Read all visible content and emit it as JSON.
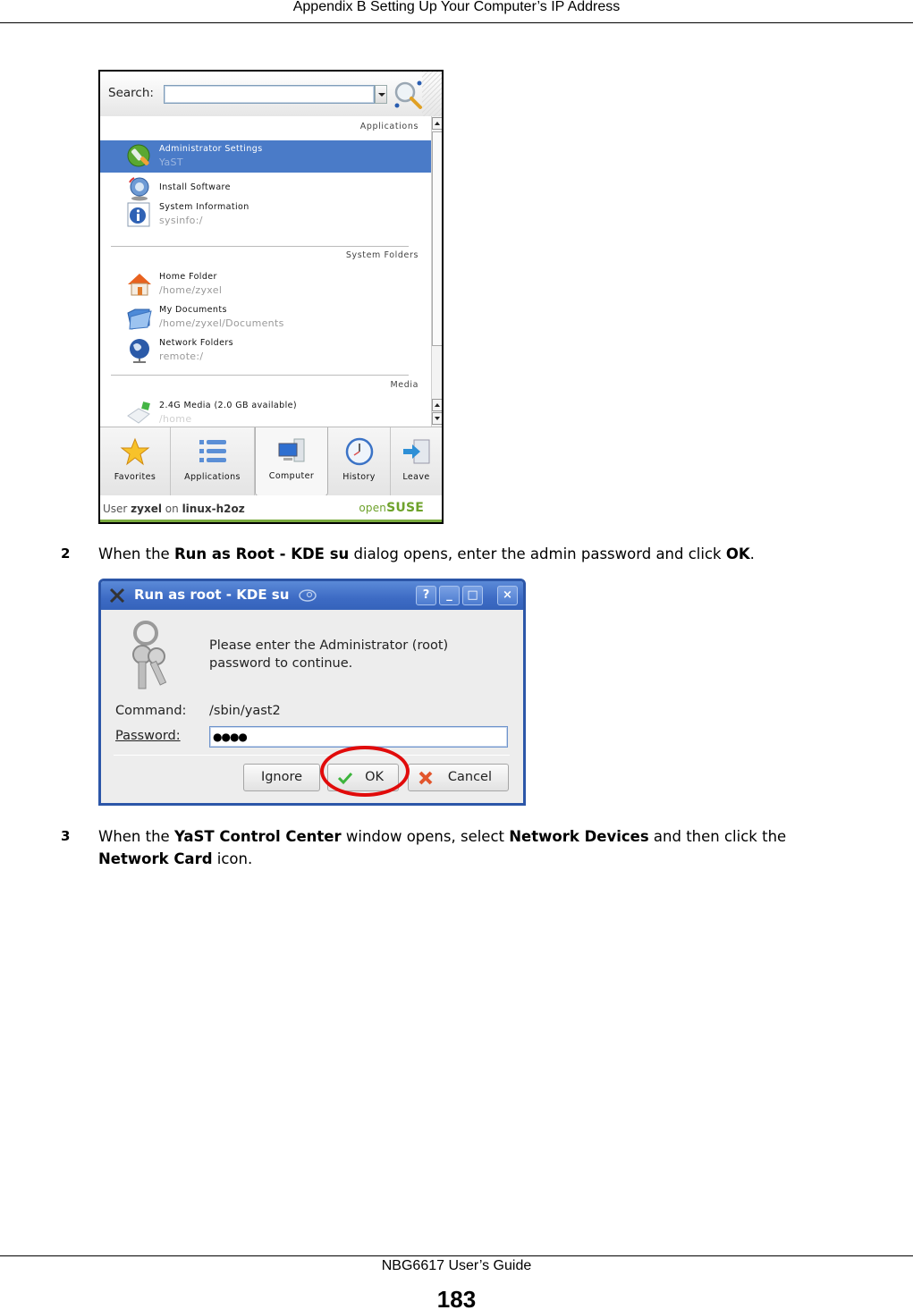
{
  "page": {
    "header": "Appendix B Setting Up Your Computer’s IP Address",
    "footer_guide": "NBG6617 User’s Guide",
    "page_number": "183"
  },
  "steps": [
    {
      "number": "2",
      "parts": [
        {
          "text": "When the ",
          "bold": false
        },
        {
          "text": "Run as Root - KDE su",
          "bold": true
        },
        {
          "text": " dialog opens, enter the admin password and click ",
          "bold": false
        },
        {
          "text": "OK",
          "bold": true
        },
        {
          "text": ".",
          "bold": false
        }
      ]
    },
    {
      "number": "3",
      "line1": [
        {
          "text": "When the ",
          "bold": false
        },
        {
          "text": "YaST Control Center",
          "bold": true
        },
        {
          "text": " window opens, select ",
          "bold": false
        },
        {
          "text": "Network Devices",
          "bold": true
        },
        {
          "text": " and then click the",
          "bold": false
        }
      ],
      "line2": [
        {
          "text": "Network Card",
          "bold": true
        },
        {
          "text": " icon.",
          "bold": false
        }
      ]
    }
  ],
  "kde_menu": {
    "search_label": "Search:",
    "search_value": "",
    "sections": {
      "applications": "Applications",
      "system_folders": "System Folders",
      "media": "Media"
    },
    "items": [
      {
        "title": "Administrator Settings",
        "subtitle": "YaST",
        "icon": "admin-settings-icon",
        "selected": true
      },
      {
        "title": "Install Software",
        "subtitle": "",
        "icon": "install-software-icon",
        "selected": false
      },
      {
        "title": "System Information",
        "subtitle": "sysinfo:/",
        "icon": "system-info-icon",
        "selected": false
      },
      {
        "title": "Home Folder",
        "subtitle": "/home/zyxel",
        "icon": "home-folder-icon",
        "selected": false
      },
      {
        "title": "My Documents",
        "subtitle": "/home/zyxel/Documents",
        "icon": "documents-folder-icon",
        "selected": false
      },
      {
        "title": "Network Folders",
        "subtitle": "remote:/",
        "icon": "network-folder-icon",
        "selected": false
      },
      {
        "title": "2.4G Media (2.0 GB available)",
        "subtitle": "/home",
        "icon": "removable-media-icon",
        "selected": false
      }
    ],
    "tabs": [
      {
        "label": "Favorites",
        "accel": "F",
        "icon": "star-icon",
        "active": false
      },
      {
        "label": "Applications",
        "accel": "A",
        "icon": "applications-list-icon",
        "active": false
      },
      {
        "label": "Computer",
        "accel": "C",
        "icon": "computer-icon",
        "active": true
      },
      {
        "label": "History",
        "accel": "H",
        "icon": "clock-icon",
        "active": false
      },
      {
        "label": "Leave",
        "accel": "L",
        "icon": "leave-icon",
        "active": false
      }
    ],
    "status": {
      "prefix": "User ",
      "user": "zyxel",
      "middle": " on ",
      "host": "linux-h2oz",
      "brand_light": "open",
      "brand_bold": "SUSE"
    }
  },
  "dialog": {
    "title": "Run as root - KDE su",
    "title_buttons": [
      "?",
      "_",
      "□",
      "×"
    ],
    "message_line1": "Please enter the Administrator (root)",
    "message_line2": "password to continue.",
    "command_label": "Command:",
    "command_value": "/sbin/yast2",
    "password_label": "Password:",
    "password_value": "●●●●",
    "buttons": {
      "ignore": "Ignore",
      "ok": "OK",
      "cancel": "Cancel"
    }
  },
  "colors": {
    "selection_blue": "#4a7bc8",
    "titlebar_blue": "#3d6bc4",
    "suse_green": "#6ea22b",
    "highlight_red": "#e10b0b"
  }
}
